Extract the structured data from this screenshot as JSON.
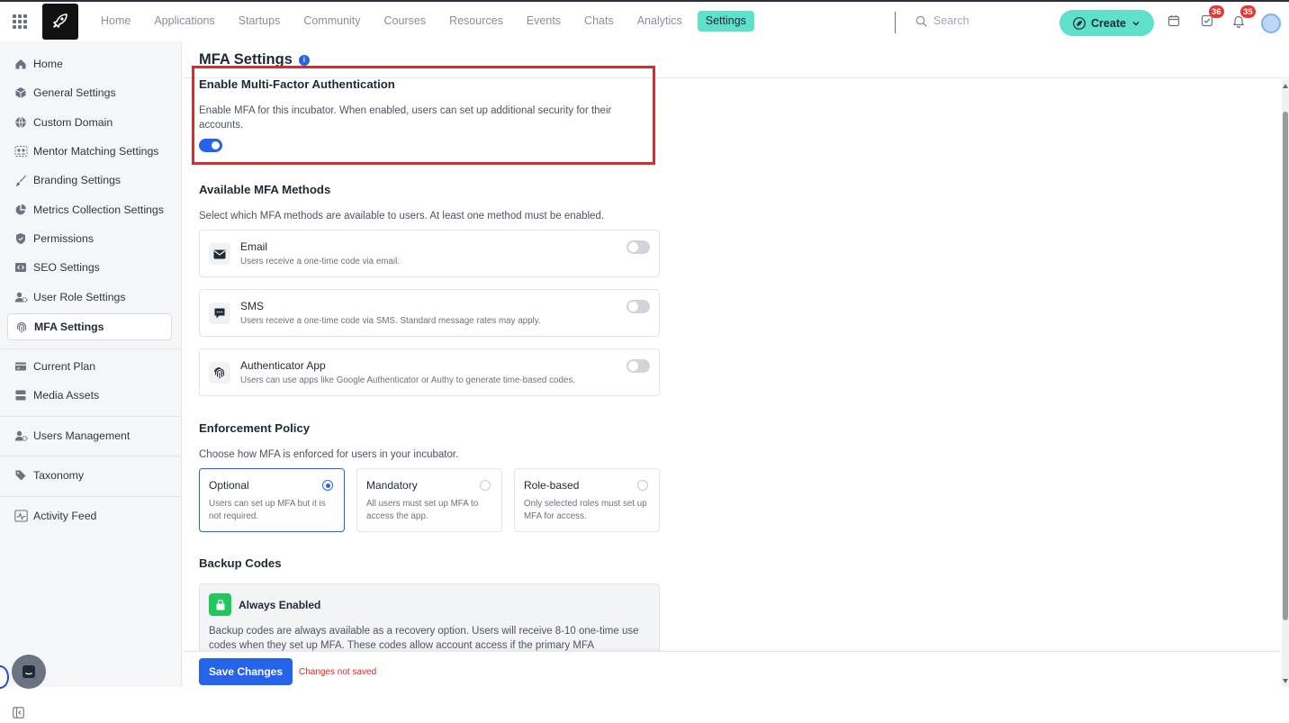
{
  "header": {
    "nav": [
      {
        "label": "Home",
        "active": false
      },
      {
        "label": "Applications",
        "active": false
      },
      {
        "label": "Startups",
        "active": false
      },
      {
        "label": "Community",
        "active": false
      },
      {
        "label": "Courses",
        "active": false
      },
      {
        "label": "Resources",
        "active": false
      },
      {
        "label": "Events",
        "active": false
      },
      {
        "label": "Chats",
        "active": false
      },
      {
        "label": "Analytics",
        "active": false
      },
      {
        "label": "Settings",
        "active": true
      }
    ],
    "search_placeholder": "Search",
    "create_label": "Create",
    "tasks_badge": "36",
    "notifications_badge": "35",
    "icons": [
      "apps-grid-icon",
      "rocket-logo",
      "search-icon",
      "calendar-icon",
      "tasks-icon",
      "bell-icon",
      "chevron-down-icon"
    ]
  },
  "sidebar": {
    "items": [
      {
        "label": "Home",
        "icon": "home-icon",
        "active": false
      },
      {
        "label": "General Settings",
        "icon": "cube-icon",
        "active": false
      },
      {
        "label": "Custom Domain",
        "icon": "globe-icon",
        "active": false
      },
      {
        "label": "Mentor Matching Settings",
        "icon": "users-match-icon",
        "active": false
      },
      {
        "label": "Branding Settings",
        "icon": "brush-icon",
        "active": false
      },
      {
        "label": "Metrics Collection Settings",
        "icon": "pie-chart-icon",
        "active": false
      },
      {
        "label": "Permissions",
        "icon": "shield-icon",
        "active": false
      },
      {
        "label": "SEO Settings",
        "icon": "code-icon",
        "active": false
      },
      {
        "label": "User Role Settings",
        "icon": "user-gear-icon",
        "active": false
      },
      {
        "label": "MFA Settings",
        "icon": "fingerprint-icon",
        "active": true
      },
      {
        "label": "Current Plan",
        "icon": "card-icon",
        "active": false
      },
      {
        "label": "Media Assets",
        "icon": "media-icon",
        "active": false
      },
      {
        "label": "Users Management",
        "icon": "users-gear-icon",
        "active": false
      },
      {
        "label": "Taxonomy",
        "icon": "tag-icon",
        "active": false
      },
      {
        "label": "Activity Feed",
        "icon": "activity-icon",
        "active": false
      }
    ]
  },
  "main": {
    "title": "MFA Settings",
    "enable": {
      "heading": "Enable Multi-Factor Authentication",
      "description": "Enable MFA for this incubator. When enabled, users can set up additional security for their accounts.",
      "enabled": true
    },
    "methods": {
      "heading": "Available MFA Methods",
      "description": "Select which MFA methods are available to users. At least one method must be enabled.",
      "items": [
        {
          "name": "Email",
          "description": "Users receive a one-time code via email.",
          "icon": "mail-icon",
          "enabled": false
        },
        {
          "name": "SMS",
          "description": "Users receive a one-time code via SMS. Standard message rates may apply.",
          "icon": "message-icon",
          "enabled": false
        },
        {
          "name": "Authenticator App",
          "description": "Users can use apps like Google Authenticator or Authy to generate time-based codes.",
          "icon": "fingerprint-icon",
          "enabled": false
        }
      ]
    },
    "policy": {
      "heading": "Enforcement Policy",
      "description": "Choose how MFA is enforced for users in your incubator.",
      "options": [
        {
          "name": "Optional",
          "description": "Users can set up MFA but it is not required.",
          "selected": true
        },
        {
          "name": "Mandatory",
          "description": "All users must set up MFA to access the app.",
          "selected": false
        },
        {
          "name": "Role-based",
          "description": "Only selected roles must set up MFA for access.",
          "selected": false
        }
      ]
    },
    "backup": {
      "heading": "Backup Codes",
      "status": "Always Enabled",
      "description": "Backup codes are always available as a recovery option. Users will receive 8-10 one-time use codes when they set up MFA. These codes allow account access if the primary MFA"
    },
    "footer": {
      "save_label": "Save Changes",
      "status": "Changes not saved"
    }
  },
  "colors": {
    "accent": "#5fe0c8",
    "primary": "#2563eb",
    "highlight": "#d32f2f",
    "badge": "#e53935",
    "success": "#22c55e",
    "warning_text": "#dc2626"
  }
}
